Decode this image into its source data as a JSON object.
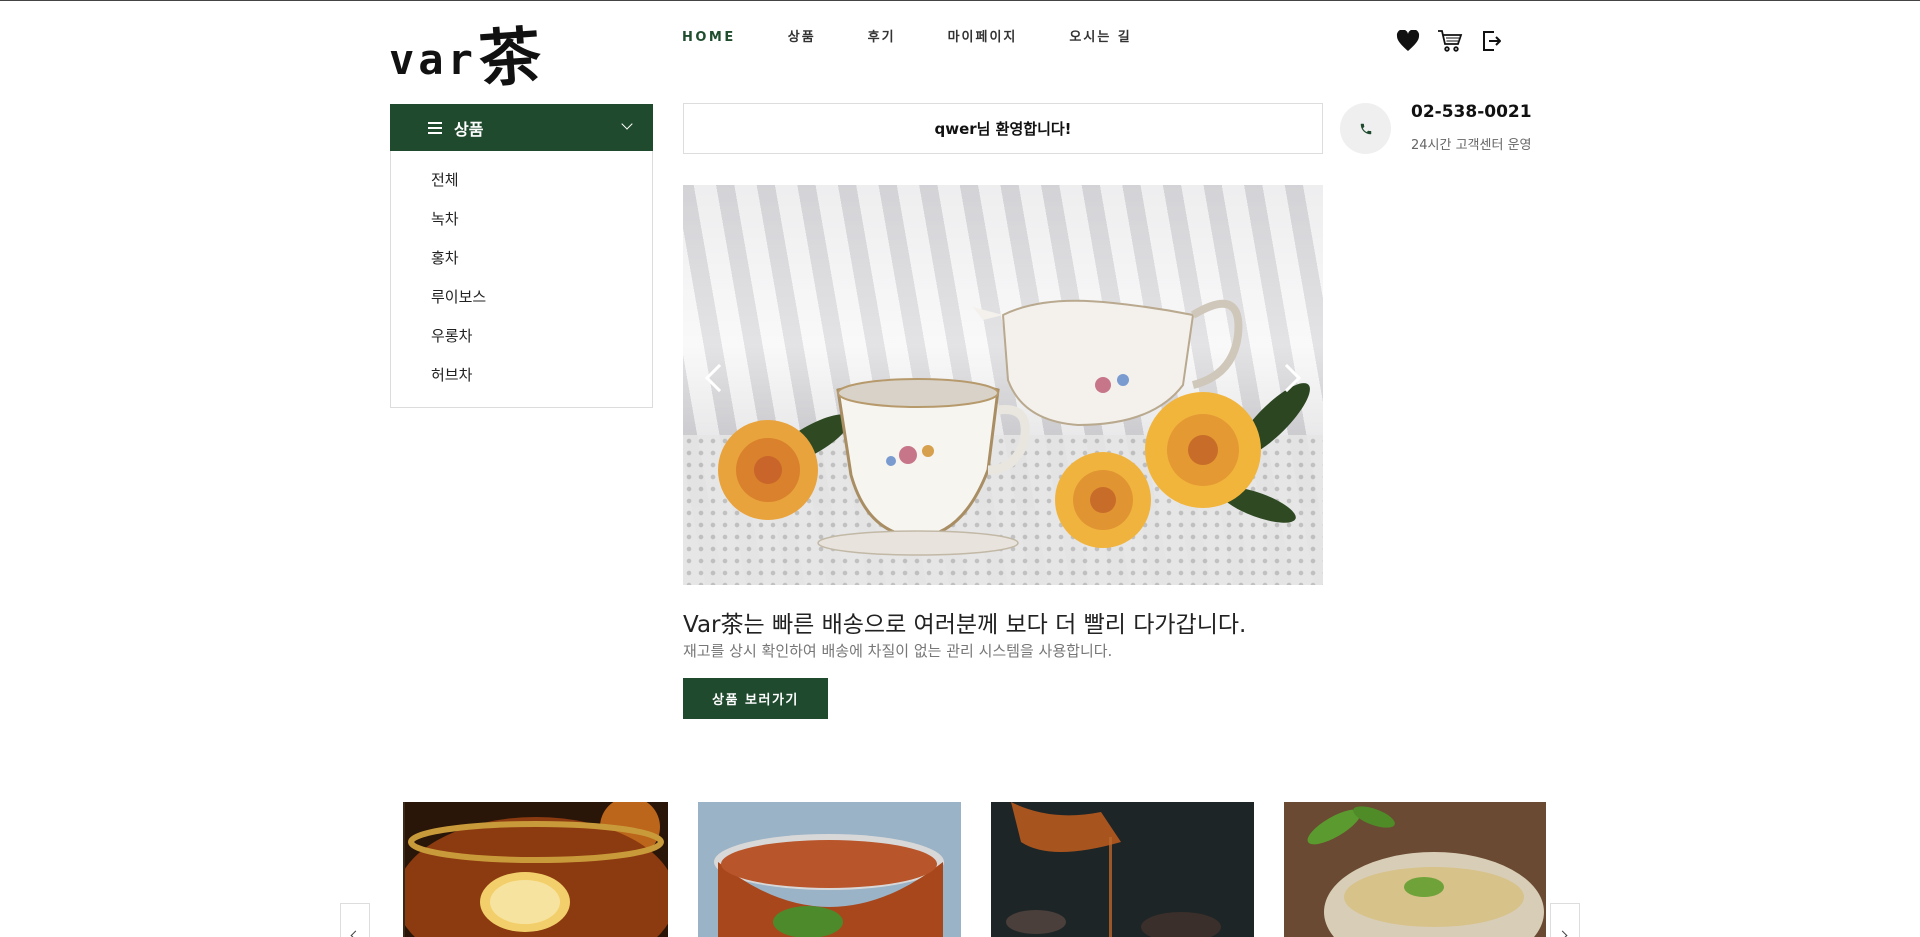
{
  "logo": {
    "latin": "var",
    "han": "茶"
  },
  "nav": {
    "items": [
      "HOME",
      "상품",
      "후기",
      "마이페이지",
      "오시는 길"
    ]
  },
  "header_icons": [
    "heart-icon",
    "cart-icon",
    "logout-icon"
  ],
  "category": {
    "title": "상품",
    "items": [
      "전체",
      "녹차",
      "홍차",
      "루이보스",
      "우롱차",
      "허브차"
    ]
  },
  "welcome": {
    "text": "qwer님 환영합니다!"
  },
  "contact": {
    "phone": "02-538-0021",
    "note": "24시간 고객센터 운영"
  },
  "hero": {
    "title": "Var茶는 빠른 배송으로 여러분께 보다 더 빨리 다가갑니다.",
    "subtitle": "재고를 상시 확인하여 배송에 차질이 없는 관리 시스템을 사용합니다.",
    "cta": "상품 보러가기"
  },
  "colors": {
    "brand_green": "#1f4a2e",
    "nav_active": "#1f4d2e"
  }
}
